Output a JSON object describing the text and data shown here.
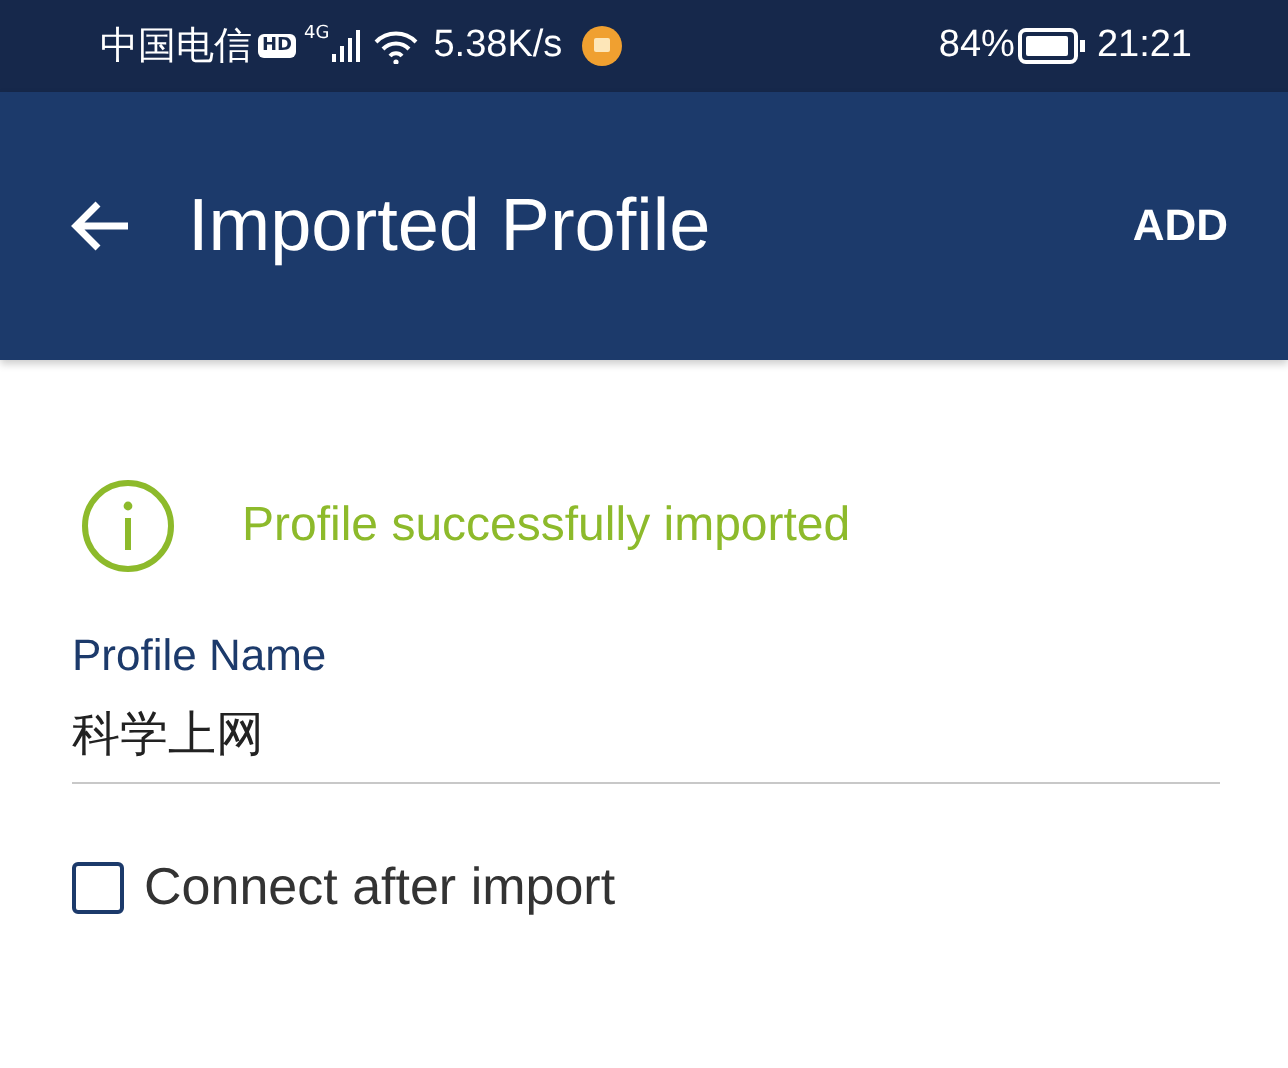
{
  "status_bar": {
    "carrier": "中国电信",
    "hd_badge": "HD",
    "network": "4G",
    "speed": "5.38K/s",
    "battery": "84%",
    "time": "21:21"
  },
  "app_bar": {
    "title": "Imported Profile",
    "action": "ADD"
  },
  "notice": {
    "text": "Profile successfully imported"
  },
  "profile_name": {
    "label": "Profile Name",
    "value": "科学上网"
  },
  "connect_after_import": {
    "label": "Connect after import",
    "checked": false
  }
}
